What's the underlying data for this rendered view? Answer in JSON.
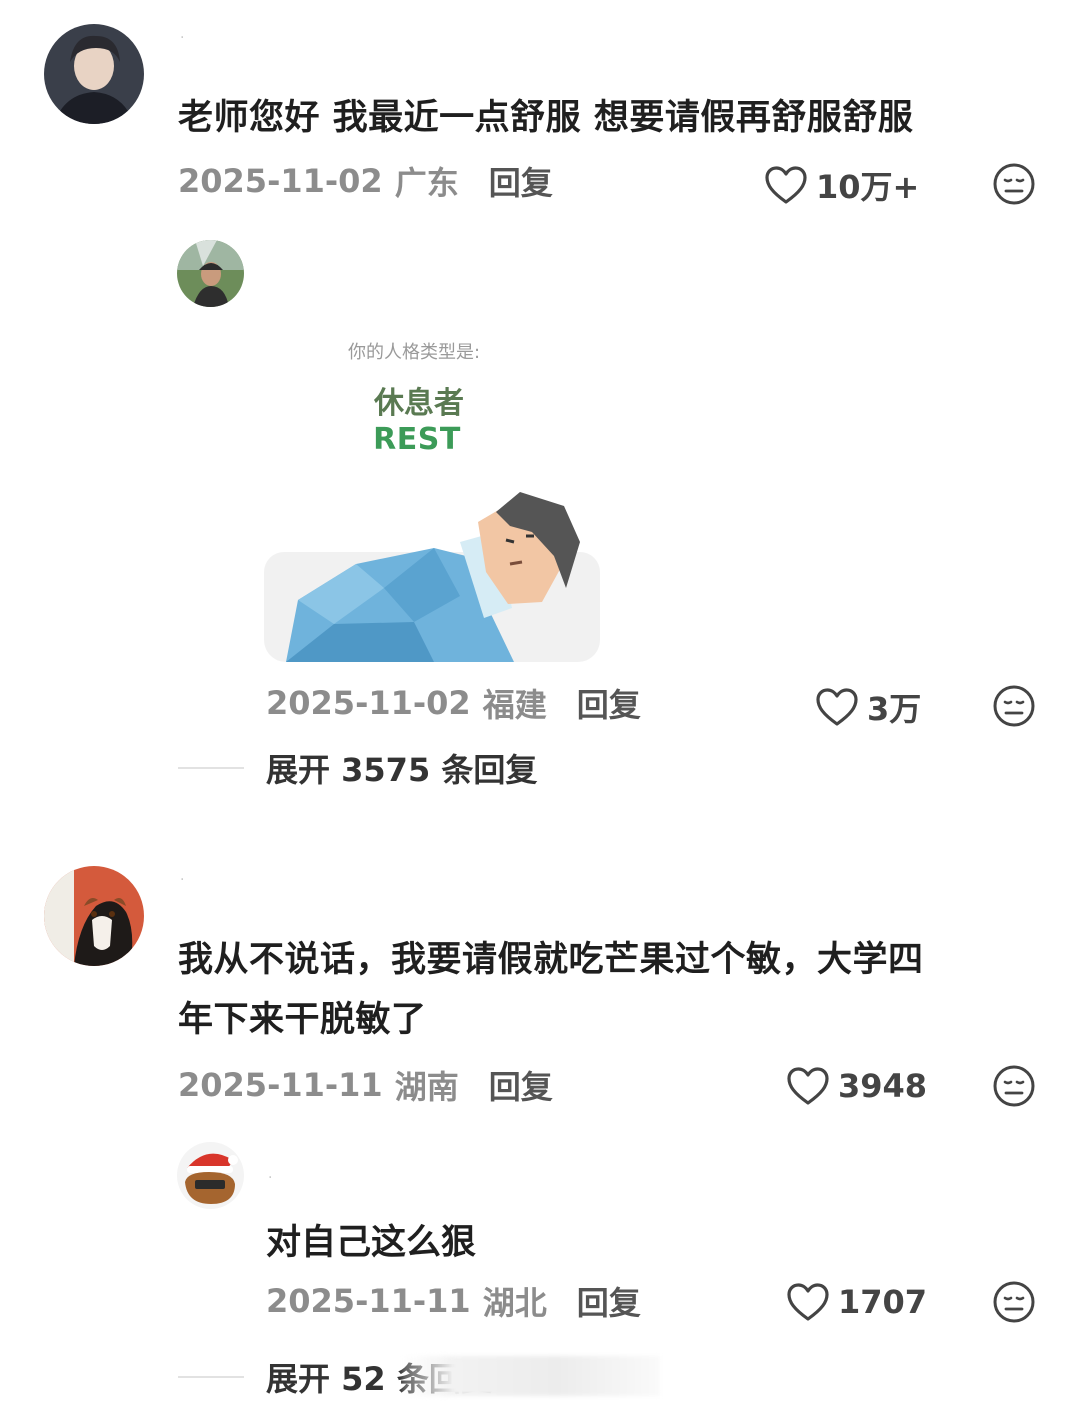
{
  "comments": [
    {
      "text": "老师您好 我最近一点舒服 想要请假再舒服舒服",
      "date": "2025-11-02",
      "location": "广东",
      "reply_label": "回复",
      "likes": "10万+",
      "reply": {
        "image_card": {
          "subtitle": "你的人格类型是:",
          "title": "休息者",
          "title_en": "REST"
        },
        "date": "2025-11-02",
        "location": "福建",
        "reply_label": "回复",
        "likes": "3万"
      },
      "expand_label": "展开 3575 条回复"
    },
    {
      "text_line1": "我从不说话，我要请假就吃芒果过个敏，大学四",
      "text_line2": "年下来干脱敏了",
      "date": "2025-11-11",
      "location": "湖南",
      "reply_label": "回复",
      "likes": "3948",
      "reply": {
        "text": "对自己这么狠",
        "date": "2025-11-11",
        "location": "湖北",
        "reply_label": "回复",
        "likes": "1707"
      },
      "expand_label": "展开 52 条回复"
    }
  ],
  "icons": {
    "like": "heart-outline-icon",
    "dislike": "meh-face-icon"
  },
  "colors": {
    "text": "#1f1f1f",
    "meta": "#8c8c8c",
    "card_title": "#5a7a52",
    "card_en": "#3c9b58",
    "blanket": "#6fb3dc"
  }
}
